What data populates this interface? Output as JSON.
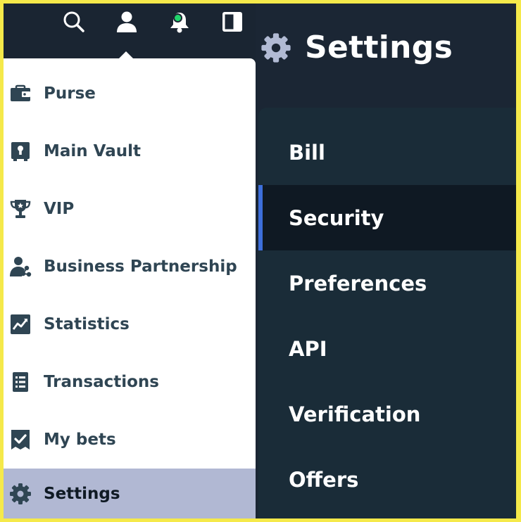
{
  "topbar": {
    "icons": [
      "search-icon",
      "user-icon",
      "bell-icon",
      "sidebar-toggle-icon"
    ],
    "notification_indicator_color": "#21d46b"
  },
  "menu": {
    "items": [
      {
        "label": "Purse",
        "icon": "wallet-icon"
      },
      {
        "label": "Main Vault",
        "icon": "vault-icon"
      },
      {
        "label": "VIP",
        "icon": "trophy-icon"
      },
      {
        "label": "Business Partnership",
        "icon": "users-icon"
      },
      {
        "label": "Statistics",
        "icon": "chart-icon"
      },
      {
        "label": "Transactions",
        "icon": "list-icon"
      },
      {
        "label": "My bets",
        "icon": "ticket-icon"
      },
      {
        "label": "Settings",
        "icon": "gear-icon",
        "active": true
      }
    ]
  },
  "page": {
    "title": "Settings",
    "title_icon": "gear-icon"
  },
  "settings_nav": {
    "items": [
      {
        "label": "Bill"
      },
      {
        "label": "Security",
        "active": true
      },
      {
        "label": "Preferences"
      },
      {
        "label": "API"
      },
      {
        "label": "Verification"
      },
      {
        "label": "Offers"
      }
    ],
    "active_color": "#3d6fdb"
  },
  "colors": {
    "frame_border": "#f5e94a",
    "background": "#1b2634",
    "menu_active": "#b1b8d3",
    "menu_text": "#2f4553"
  }
}
